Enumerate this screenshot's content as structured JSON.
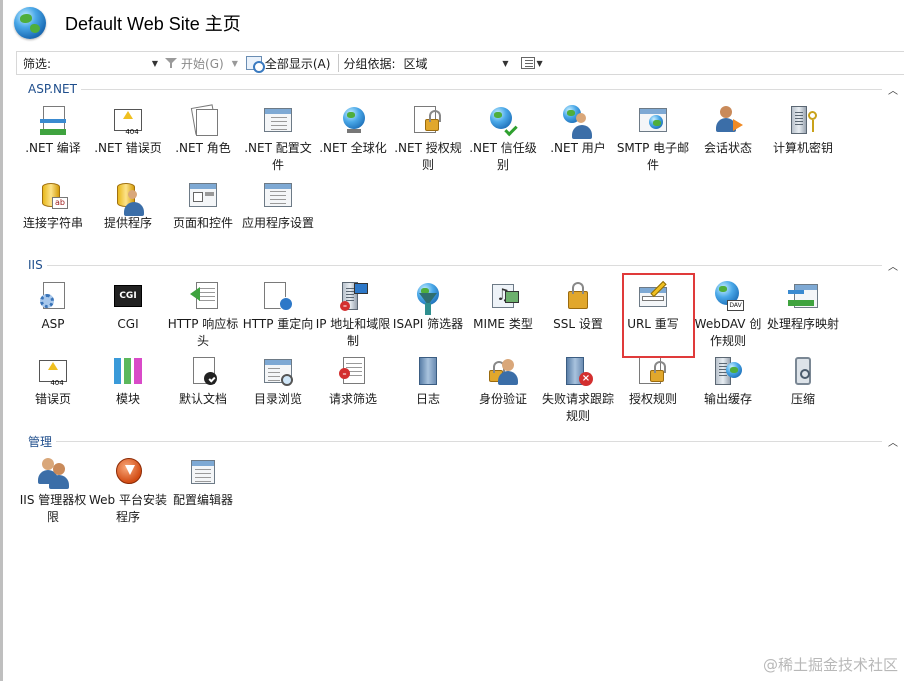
{
  "header": {
    "title": "Default Web Site 主页",
    "icon": "globe-icon"
  },
  "toolbar": {
    "filter_label": "筛选:",
    "filter_value": "",
    "start_label": "开始(G)",
    "show_all_label": "全部显示(A)",
    "group_by_label": "分组依据:",
    "group_by_value": "区域"
  },
  "sections": [
    {
      "title": "ASP.NET",
      "items": [
        {
          "label": ".NET 编译",
          "icon": "net-compile-icon"
        },
        {
          "label": ".NET 错误页",
          "icon": "net-error-pages-icon"
        },
        {
          "label": ".NET 角色",
          "icon": "net-roles-icon"
        },
        {
          "label": ".NET 配置文件",
          "icon": "net-profile-icon"
        },
        {
          "label": ".NET 全球化",
          "icon": "net-globalization-icon"
        },
        {
          "label": ".NET 授权规则",
          "icon": "net-authorization-rules-icon"
        },
        {
          "label": ".NET 信任级别",
          "icon": "net-trust-levels-icon"
        },
        {
          "label": ".NET 用户",
          "icon": "net-users-icon"
        },
        {
          "label": "SMTP 电子邮件",
          "icon": "smtp-email-icon"
        },
        {
          "label": "会话状态",
          "icon": "session-state-icon"
        },
        {
          "label": "计算机密钥",
          "icon": "machine-key-icon"
        },
        {
          "label": "连接字符串",
          "icon": "connection-strings-icon"
        },
        {
          "label": "提供程序",
          "icon": "providers-icon"
        },
        {
          "label": "页面和控件",
          "icon": "pages-controls-icon"
        },
        {
          "label": "应用程序设置",
          "icon": "app-settings-icon"
        }
      ]
    },
    {
      "title": "IIS",
      "items": [
        {
          "label": "ASP",
          "icon": "asp-icon"
        },
        {
          "label": "CGI",
          "icon": "cgi-icon"
        },
        {
          "label": "HTTP 响应标头",
          "icon": "http-response-headers-icon"
        },
        {
          "label": "HTTP 重定向",
          "icon": "http-redirect-icon"
        },
        {
          "label": "IP 地址和域限制",
          "icon": "ip-domain-restrictions-icon"
        },
        {
          "label": "ISAPI 筛选器",
          "icon": "isapi-filters-icon"
        },
        {
          "label": "MIME 类型",
          "icon": "mime-types-icon"
        },
        {
          "label": "SSL 设置",
          "icon": "ssl-settings-icon"
        },
        {
          "label": "URL 重写",
          "icon": "url-rewrite-icon"
        },
        {
          "label": "WebDAV 创作规则",
          "icon": "webdav-authoring-icon"
        },
        {
          "label": "处理程序映射",
          "icon": "handler-mappings-icon"
        },
        {
          "label": "错误页",
          "icon": "error-pages-icon"
        },
        {
          "label": "模块",
          "icon": "modules-icon"
        },
        {
          "label": "默认文档",
          "icon": "default-document-icon"
        },
        {
          "label": "目录浏览",
          "icon": "directory-browsing-icon"
        },
        {
          "label": "请求筛选",
          "icon": "request-filtering-icon"
        },
        {
          "label": "日志",
          "icon": "logging-icon"
        },
        {
          "label": "身份验证",
          "icon": "authentication-icon"
        },
        {
          "label": "失败请求跟踪规则",
          "icon": "failed-request-tracing-icon"
        },
        {
          "label": "授权规则",
          "icon": "authorization-rules-icon"
        },
        {
          "label": "输出缓存",
          "icon": "output-caching-icon"
        },
        {
          "label": "压缩",
          "icon": "compression-icon"
        }
      ]
    },
    {
      "title": "管理",
      "items": [
        {
          "label": "IIS 管理器权限",
          "icon": "iis-manager-permissions-icon"
        },
        {
          "label": "Web 平台安装程序",
          "icon": "web-platform-installer-icon"
        },
        {
          "label": "配置编辑器",
          "icon": "configuration-editor-icon"
        }
      ]
    }
  ],
  "watermark": "@稀土掘金技术社区",
  "colors": {
    "section_title": "#1f4e8c",
    "highlight": "#e03a3a"
  }
}
